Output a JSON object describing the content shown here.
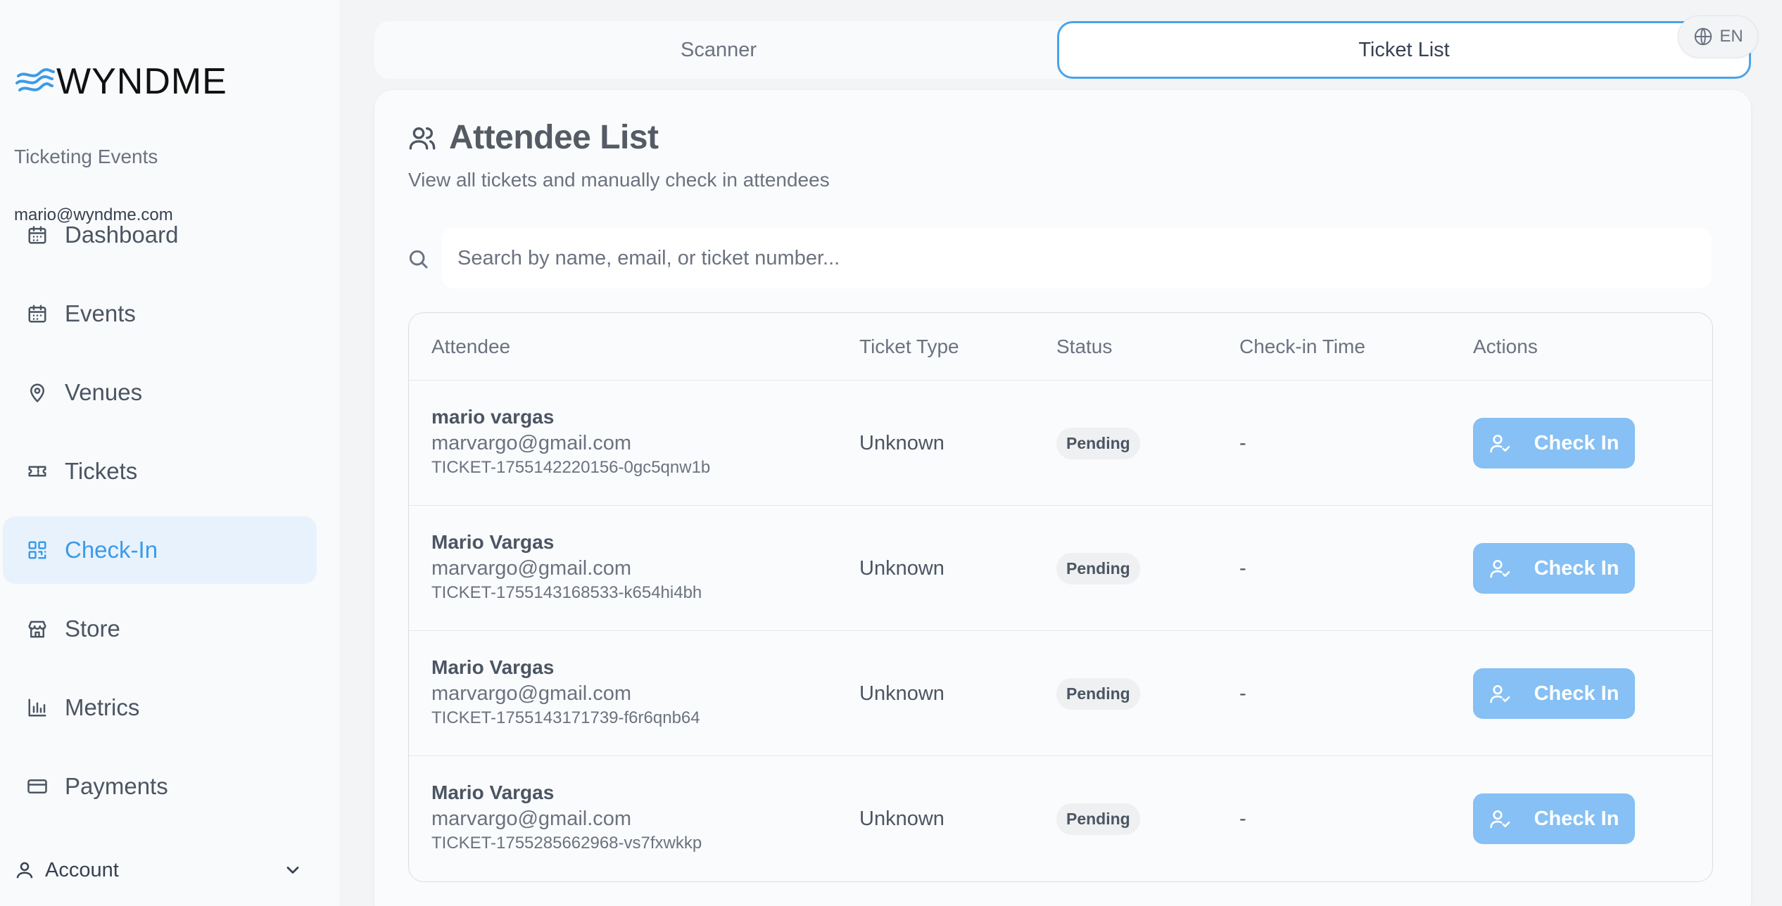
{
  "brand": {
    "logo_text": "WYNDME",
    "accent": "#3b9be8"
  },
  "sidebar": {
    "org_name": "Ticketing Events",
    "user_email": "mario@wyndme.com",
    "items": [
      {
        "label": "Dashboard",
        "icon": "calendar-icon",
        "active": false
      },
      {
        "label": "Events",
        "icon": "calendar-icon",
        "active": false
      },
      {
        "label": "Venues",
        "icon": "map-pin-icon",
        "active": false
      },
      {
        "label": "Tickets",
        "icon": "ticket-icon",
        "active": false
      },
      {
        "label": "Check-In",
        "icon": "qr-code-icon",
        "active": true
      },
      {
        "label": "Store",
        "icon": "store-icon",
        "active": false
      },
      {
        "label": "Metrics",
        "icon": "bar-chart-icon",
        "active": false
      },
      {
        "label": "Payments",
        "icon": "credit-card-icon",
        "active": false
      }
    ],
    "account_label": "Account"
  },
  "header": {
    "tabs": [
      {
        "label": "Scanner",
        "active": false
      },
      {
        "label": "Ticket List",
        "active": true
      }
    ],
    "language": "EN"
  },
  "main": {
    "title": "Attendee List",
    "subtitle": "View all tickets and manually check in attendees",
    "search": {
      "placeholder": "Search by name, email, or ticket number...",
      "value": ""
    },
    "table": {
      "columns": [
        "Attendee",
        "Ticket Type",
        "Status",
        "Check-in Time",
        "Actions"
      ],
      "rows": [
        {
          "name": "mario vargas",
          "email": "marvargo@gmail.com",
          "ticket": "TICKET-1755142220156-0gc5qnw1b",
          "type": "Unknown",
          "status": "Pending",
          "time": "-",
          "action": "Check In"
        },
        {
          "name": "Mario Vargas",
          "email": "marvargo@gmail.com",
          "ticket": "TICKET-1755143168533-k654hi4bh",
          "type": "Unknown",
          "status": "Pending",
          "time": "-",
          "action": "Check In"
        },
        {
          "name": "Mario Vargas",
          "email": "marvargo@gmail.com",
          "ticket": "TICKET-1755143171739-f6r6qnb64",
          "type": "Unknown",
          "status": "Pending",
          "time": "-",
          "action": "Check In"
        },
        {
          "name": "Mario Vargas",
          "email": "marvargo@gmail.com",
          "ticket": "TICKET-1755285662968-vs7fxwkkp",
          "type": "Unknown",
          "status": "Pending",
          "time": "-",
          "action": "Check In"
        }
      ]
    }
  }
}
